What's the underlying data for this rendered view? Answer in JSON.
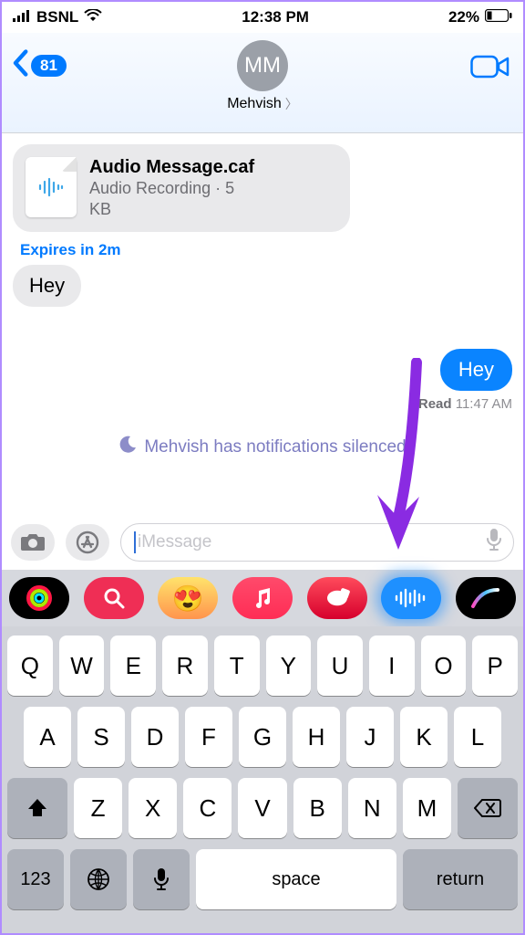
{
  "status": {
    "carrier": "BSNL",
    "time": "12:38 PM",
    "battery_pct": "22%"
  },
  "header": {
    "back_count": "81",
    "avatar_initials": "MM",
    "contact_name": "Mehvish"
  },
  "messages": {
    "audio_file": {
      "title": "Audio Message.caf",
      "subtitle_line1": "Audio Recording · 5",
      "subtitle_line2": "KB"
    },
    "expires": "Expires in 2m",
    "incoming_text": "Hey",
    "outgoing_text": "Hey",
    "read_label": "Read",
    "read_time": "11:47 AM",
    "silenced_text": "Mehvish has notifications silenced"
  },
  "input": {
    "placeholder": "iMessage"
  },
  "keyboard": {
    "row1": [
      "Q",
      "W",
      "E",
      "R",
      "T",
      "Y",
      "U",
      "I",
      "O",
      "P"
    ],
    "row2": [
      "A",
      "S",
      "D",
      "F",
      "G",
      "H",
      "J",
      "K",
      "L"
    ],
    "row3": [
      "Z",
      "X",
      "C",
      "V",
      "B",
      "N",
      "M"
    ],
    "numbers": "123",
    "space": "space",
    "return": "return"
  }
}
